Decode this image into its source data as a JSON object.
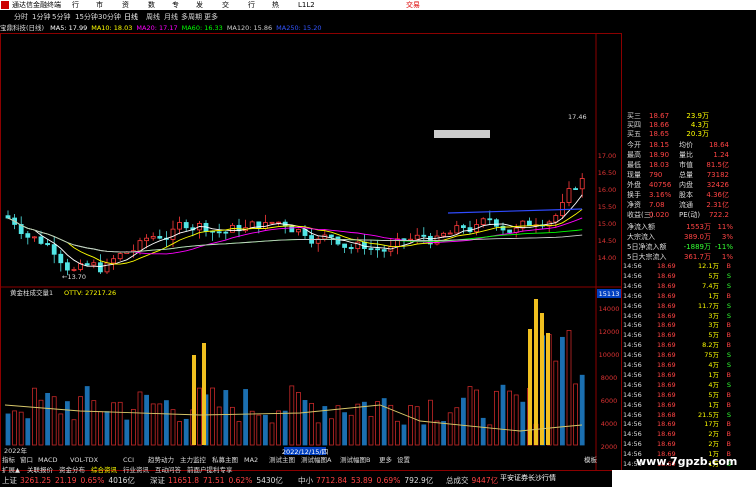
{
  "window": {
    "title": "通达信金融终端",
    "trade_label": "交易"
  },
  "menu": [
    "行情",
    "市场",
    "资讯",
    "数据",
    "专题",
    "发现",
    "交易",
    "行业",
    "热点",
    "L1L2"
  ],
  "periods": [
    "分时",
    "1分钟",
    "5分钟",
    "15分钟",
    "30分钟",
    "日线",
    "周线",
    "月线",
    "多周期",
    "更多"
  ],
  "active_period": "日线",
  "ma_bar": {
    "stock": "宝鼎科技(日线)",
    "items": [
      {
        "label": "MA5: 17.99",
        "color": "#ffffff"
      },
      {
        "label": "MA10: 18.03",
        "color": "#ffff00"
      },
      {
        "label": "MA20: 17.17",
        "color": "#ff00ff"
      },
      {
        "label": "MA60: 16.33",
        "color": "#00ff00"
      },
      {
        "label": "MA120: 15.86",
        "color": "#cccccc"
      },
      {
        "label": "MA250: 15.20",
        "color": "#3355ff"
      }
    ]
  },
  "price_axis": [
    "17.00",
    "16.50",
    "16.00",
    "15.50",
    "15.00",
    "14.50",
    "14.00"
  ],
  "chart_data": {
    "type": "candlestick",
    "low_label": "13.70",
    "high_label": "17.46",
    "ylim": [
      13.5,
      18.0
    ]
  },
  "indicator_panel": {
    "title": "黄金柱成交量1",
    "label": "OTTV: 27217.26",
    "value_box": "15113",
    "axis": [
      "14000",
      "12000",
      "10000",
      "8000",
      "6000",
      "4000",
      "2000"
    ]
  },
  "date_axis": {
    "year": "2022年",
    "cursor": "2022/12/15/四"
  },
  "order_book": [
    {
      "label": "买三",
      "price": "18.67",
      "vol": "23.9万"
    },
    {
      "label": "买四",
      "price": "18.66",
      "vol": "4.3万"
    },
    {
      "label": "买五",
      "price": "18.65",
      "vol": "20.3万"
    }
  ],
  "quote": [
    {
      "l": "今开",
      "v": "18.15",
      "l2": "均价",
      "v2": "18.64"
    },
    {
      "l": "最高",
      "v": "18.90",
      "l2": "量比",
      "v2": "1.24"
    },
    {
      "l": "最低",
      "v": "18.03",
      "l2": "市值",
      "v2": "81.5亿"
    },
    {
      "l": "现量",
      "v": "790",
      "l2": "总量",
      "v2": "73182"
    },
    {
      "l": "外盘",
      "v": "40756",
      "l2": "内盘",
      "v2": "32426"
    },
    {
      "l": "换手",
      "v": "3.16%",
      "l2": "股本",
      "v2": "4.36亿"
    },
    {
      "l": "净资",
      "v": "7.08",
      "l2": "流通",
      "v2": "2.31亿"
    },
    {
      "l": "收益(三)",
      "v": "0.020",
      "l2": "PE(动)",
      "v2": "722.2"
    }
  ],
  "flows": [
    {
      "l": "净流入额",
      "v": "1553万",
      "p": "11%"
    },
    {
      "l": "大宗流入",
      "v": "389.0万",
      "p": "3%"
    },
    {
      "l": "5日净流入额",
      "v": "-1889万",
      "p": "-11%"
    },
    {
      "l": "5日大宗流入",
      "v": "361.7万",
      "p": "1%"
    }
  ],
  "ticks": [
    {
      "t": "14:56",
      "p": "18.69",
      "v": "12.1万",
      "s": "B"
    },
    {
      "t": "14:56",
      "p": "18.69",
      "v": "5万",
      "s": "S"
    },
    {
      "t": "14:56",
      "p": "18.69",
      "v": "7.4万",
      "s": "S"
    },
    {
      "t": "14:56",
      "p": "18.69",
      "v": "1万",
      "s": "B"
    },
    {
      "t": "14:56",
      "p": "18.69",
      "v": "11.7万",
      "s": "S"
    },
    {
      "t": "14:56",
      "p": "18.69",
      "v": "3万",
      "s": "S"
    },
    {
      "t": "14:56",
      "p": "18.69",
      "v": "3万",
      "s": "B"
    },
    {
      "t": "14:56",
      "p": "18.69",
      "v": "5万",
      "s": "B"
    },
    {
      "t": "14:56",
      "p": "18.69",
      "v": "8.2万",
      "s": "B"
    },
    {
      "t": "14:56",
      "p": "18.69",
      "v": "75万",
      "s": "S"
    },
    {
      "t": "14:56",
      "p": "18.69",
      "v": "4万",
      "s": "S"
    },
    {
      "t": "14:56",
      "p": "18.69",
      "v": "1万",
      "s": "B"
    },
    {
      "t": "14:56",
      "p": "18.69",
      "v": "4万",
      "s": "S"
    },
    {
      "t": "14:56",
      "p": "18.69",
      "v": "5万",
      "s": "B"
    },
    {
      "t": "14:56",
      "p": "18.69",
      "v": "1万",
      "s": "B"
    },
    {
      "t": "14:56",
      "p": "18.68",
      "v": "21.5万",
      "s": "S"
    },
    {
      "t": "14:56",
      "p": "18.69",
      "v": "17万",
      "s": "B"
    },
    {
      "t": "14:56",
      "p": "18.69",
      "v": "2万",
      "s": "B"
    },
    {
      "t": "14:56",
      "p": "18.69",
      "v": "2万",
      "s": "B"
    },
    {
      "t": "14:56",
      "p": "18.69",
      "v": "1万",
      "s": "B"
    },
    {
      "t": "14:56",
      "p": "18.69",
      "v": "1万",
      "s": "S"
    }
  ],
  "toolbar_tabs": [
    "指标",
    "窗口",
    "MACD",
    "VOL-TDX",
    "CCI",
    "趋势动力",
    "主力监控",
    "私募主图",
    "MA2",
    "测试主图",
    "测试幅图A",
    "测试幅图B",
    "更多",
    "设置"
  ],
  "bottom_tabs": [
    "扩展▲",
    "关联报价",
    "资金分布",
    "综合资讯",
    "行业资讯",
    "互动问答",
    "前面户提利专享"
  ],
  "cursor_tab": "模板",
  "indices": [
    {
      "n": "上证",
      "v": "3261.25",
      "c": "21.19",
      "p": "0.65%",
      "a": "4016亿"
    },
    {
      "n": "深证",
      "v": "11651.8",
      "c": "71.51",
      "p": "0.62%",
      "a": "5430亿"
    },
    {
      "n": "中小",
      "v": "7712.84",
      "c": "53.89",
      "p": "0.69%",
      "a": "792.9亿"
    },
    {
      "n": "总成交",
      "v": "9447亿",
      "c": "",
      "p": "",
      "a": ""
    }
  ],
  "status_right": "平安证券长沙行情",
  "watermark": "www.7gpzb.com"
}
